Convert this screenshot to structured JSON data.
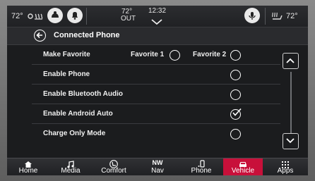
{
  "status_bar": {
    "left_temp": "72°",
    "outside_temp": "72°",
    "outside_label": "OUT",
    "time": "12:32",
    "right_temp": "72°"
  },
  "header": {
    "title": "Connected Phone"
  },
  "settings": {
    "make_favorite": {
      "label": "Make Favorite",
      "option1": "Favorite 1",
      "option2": "Favorite 2"
    },
    "rows": [
      {
        "label": "Enable Phone",
        "checked": false
      },
      {
        "label": "Enable Bluetooth Audio",
        "checked": false
      },
      {
        "label": "Enable Android Auto",
        "checked": true
      },
      {
        "label": "Charge Only Mode",
        "checked": false
      }
    ]
  },
  "nav": {
    "items": [
      {
        "label": "Home",
        "icon": "home-icon"
      },
      {
        "label": "Media",
        "icon": "music-note-icon"
      },
      {
        "label": "Comfort",
        "icon": "seat-icon"
      },
      {
        "label": "Nav",
        "icon": "compass-icon",
        "icon_text": "NW"
      },
      {
        "label": "Phone",
        "icon": "phone-icon"
      },
      {
        "label": "Vehicle",
        "icon": "car-icon",
        "active": true
      },
      {
        "label": "Apps",
        "icon": "apps-grid-icon"
      }
    ]
  },
  "colors": {
    "active_tab": "#c8103a",
    "background": "#1b1c1e"
  }
}
